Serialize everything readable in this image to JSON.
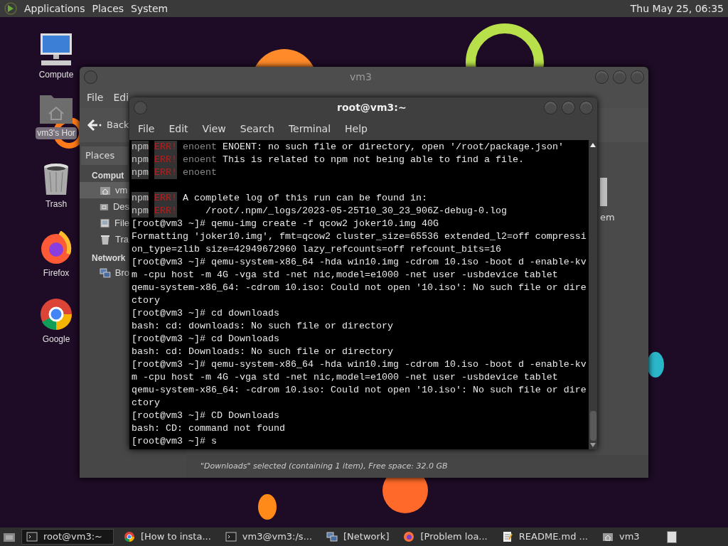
{
  "top_panel": {
    "menus": [
      "Applications",
      "Places",
      "System"
    ],
    "clock": "Thu May 25, 06:35"
  },
  "desktop_icons": [
    {
      "label": "Compute",
      "kind": "computer",
      "selected": false
    },
    {
      "label": "vm3's Hor",
      "kind": "home",
      "selected": true
    },
    {
      "label": "Trash",
      "kind": "trash",
      "selected": false
    },
    {
      "label": "Firefox",
      "kind": "firefox",
      "selected": false
    },
    {
      "label": "Google",
      "kind": "chrome",
      "selected": false
    }
  ],
  "file_manager": {
    "title": "vm3",
    "menu": [
      "File",
      "Edi"
    ],
    "back": "Back",
    "places_button": "Places",
    "sections": [
      {
        "heading": "Comput",
        "items": [
          {
            "label": "vm",
            "kind": "home",
            "selected": true
          },
          {
            "label": "Des",
            "kind": "desktop",
            "selected": false
          },
          {
            "label": "File",
            "kind": "drive",
            "selected": false
          },
          {
            "label": "Tra",
            "kind": "trash",
            "selected": false
          }
        ]
      },
      {
        "heading": "Network",
        "items": [
          {
            "label": "Bro",
            "kind": "network",
            "selected": false
          }
        ]
      }
    ],
    "content_item": "em",
    "status": "\"Downloads\" selected (containing 1 item), Free space: 32.0 GB"
  },
  "terminal": {
    "title": "root@vm3:~",
    "menu": [
      "File",
      "Edit",
      "View",
      "Search",
      "Terminal",
      "Help"
    ],
    "lines": [
      {
        "kind": "npm",
        "prefix": "npm",
        "tag": "ERR!",
        "code": "enoent",
        "text": "ENOENT: no such file or directory, open '/root/package.json'"
      },
      {
        "kind": "npm",
        "prefix": "npm",
        "tag": "ERR!",
        "code": "enoent",
        "text": "This is related to npm not being able to find a file."
      },
      {
        "kind": "npm",
        "prefix": "npm",
        "tag": "ERR!",
        "code": "enoent"
      },
      {
        "kind": "blank"
      },
      {
        "kind": "npm",
        "prefix": "npm",
        "tag": "ERR!",
        "text": "A complete log of this run can be found in:"
      },
      {
        "kind": "npm",
        "prefix": "npm",
        "tag": "ERR!",
        "text": "    /root/.npm/_logs/2023-05-25T10_30_23_906Z-debug-0.log"
      },
      {
        "kind": "plain",
        "text": "[root@vm3 ~]# qemu-img create -f qcow2 joker10.img 40G"
      },
      {
        "kind": "plain",
        "text": "Formatting 'joker10.img', fmt=qcow2 cluster_size=65536 extended_l2=off compressi"
      },
      {
        "kind": "plain",
        "text": "on_type=zlib size=42949672960 lazy_refcounts=off refcount_bits=16"
      },
      {
        "kind": "plain",
        "text": "[root@vm3 ~]# qemu-system-x86_64 -hda win10.img -cdrom 10.iso -boot d -enable-kv"
      },
      {
        "kind": "plain",
        "text": "m -cpu host -m 4G -vga std -net nic,model=e1000 -net user -usbdevice tablet"
      },
      {
        "kind": "plain",
        "text": "qemu-system-x86_64: -cdrom 10.iso: Could not open '10.iso': No such file or dire"
      },
      {
        "kind": "plain",
        "text": "ctory"
      },
      {
        "kind": "plain",
        "text": "[root@vm3 ~]# cd downloads"
      },
      {
        "kind": "plain",
        "text": "bash: cd: downloads: No such file or directory"
      },
      {
        "kind": "plain",
        "text": "[root@vm3 ~]# cd Downloads"
      },
      {
        "kind": "plain",
        "text": "bash: cd: Downloads: No such file or directory"
      },
      {
        "kind": "plain",
        "text": "[root@vm3 ~]# qemu-system-x86_64 -hda win10.img -cdrom 10.iso -boot d -enable-kv"
      },
      {
        "kind": "plain",
        "text": "m -cpu host -m 4G -vga std -net nic,model=e1000 -net user -usbdevice tablet"
      },
      {
        "kind": "plain",
        "text": "qemu-system-x86_64: -cdrom 10.iso: Could not open '10.iso': No such file or dire"
      },
      {
        "kind": "plain",
        "text": "ctory"
      },
      {
        "kind": "plain",
        "text": "[root@vm3 ~]# CD Downloads"
      },
      {
        "kind": "plain",
        "text": "bash: CD: command not found"
      },
      {
        "kind": "plain",
        "text": "[root@vm3 ~]# s"
      }
    ]
  },
  "taskbar": {
    "items": [
      {
        "label": "root@vm3:~",
        "kind": "terminal",
        "selected": true
      },
      {
        "label": "[How to insta...",
        "kind": "chrome",
        "selected": false
      },
      {
        "label": "vm3@vm3:/s...",
        "kind": "terminal",
        "selected": false
      },
      {
        "label": "[Network]",
        "kind": "network",
        "selected": false
      },
      {
        "label": "[Problem loa...",
        "kind": "firefox",
        "selected": false
      },
      {
        "label": "README.md ...",
        "kind": "editor",
        "selected": false
      },
      {
        "label": "vm3",
        "kind": "home",
        "selected": false
      }
    ]
  }
}
